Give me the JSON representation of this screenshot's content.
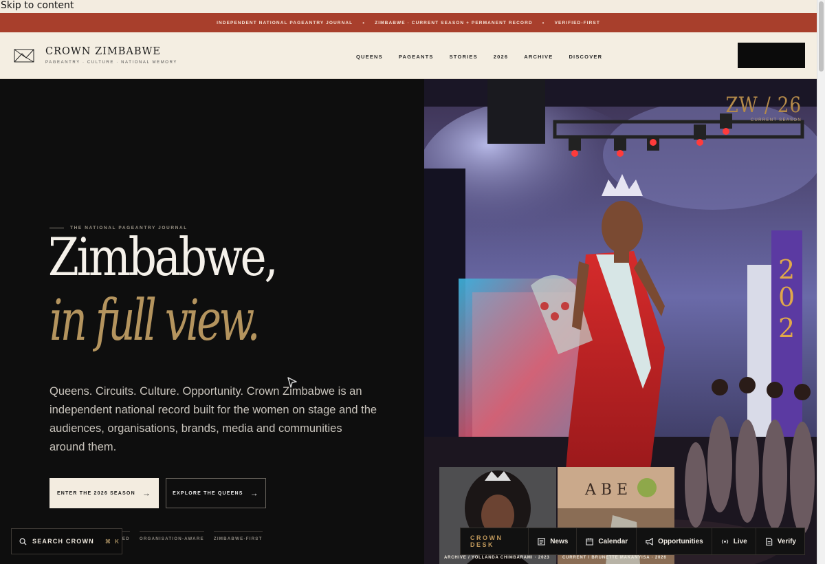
{
  "skip_link": "Skip to content",
  "topbar": {
    "items": [
      "Independent National Pageantry Journal",
      "Zimbabwe · Current Season + Permanent Record",
      "Verified-First"
    ],
    "separator": "•"
  },
  "header": {
    "brand_name": "CROWN ZIMBABWE",
    "brand_tagline": "Pageantry · Culture · National Memory",
    "nav": [
      "Queens",
      "Pageants",
      "Stories",
      "2026",
      "Archive",
      "Discover"
    ]
  },
  "hero": {
    "eyebrow": "The National Pageantry Journal",
    "headline_line1": "Zimbabwe,",
    "headline_line2": "in full view.",
    "lede": "Queens. Circuits. Culture. Opportunity. Crown Zimbabwe is an independent national record built for the women on stage and the audiences, organisations, brands, media and communities around them.",
    "primary_cta": "Enter the 2026 Season",
    "secondary_cta": "Explore the Queens",
    "pills": [
      "E-Linked",
      "Organisation-Aware",
      "Zimbabwe-First"
    ],
    "accent_color": "#b4945e"
  },
  "season_mark": {
    "code": "ZW / 26",
    "label": "Current Season"
  },
  "search": {
    "label": "SEARCH CROWN",
    "shortcut": "⌘ K"
  },
  "thumbnails": [
    {
      "caption": "Archive / Yollanda Chimbarami · 2023"
    },
    {
      "caption": "Current / Brunette Makanyisa · 2026"
    }
  ],
  "crown_desk": {
    "title": "CROWN DESK",
    "items": [
      {
        "label": "News",
        "icon": "newspaper-icon"
      },
      {
        "label": "Calendar",
        "icon": "calendar-icon"
      },
      {
        "label": "Opportunities",
        "icon": "megaphone-icon"
      },
      {
        "label": "Live",
        "icon": "broadcast-icon"
      },
      {
        "label": "Verify",
        "icon": "document-check-icon"
      }
    ]
  },
  "stage_banner_digits": "2 0 2"
}
